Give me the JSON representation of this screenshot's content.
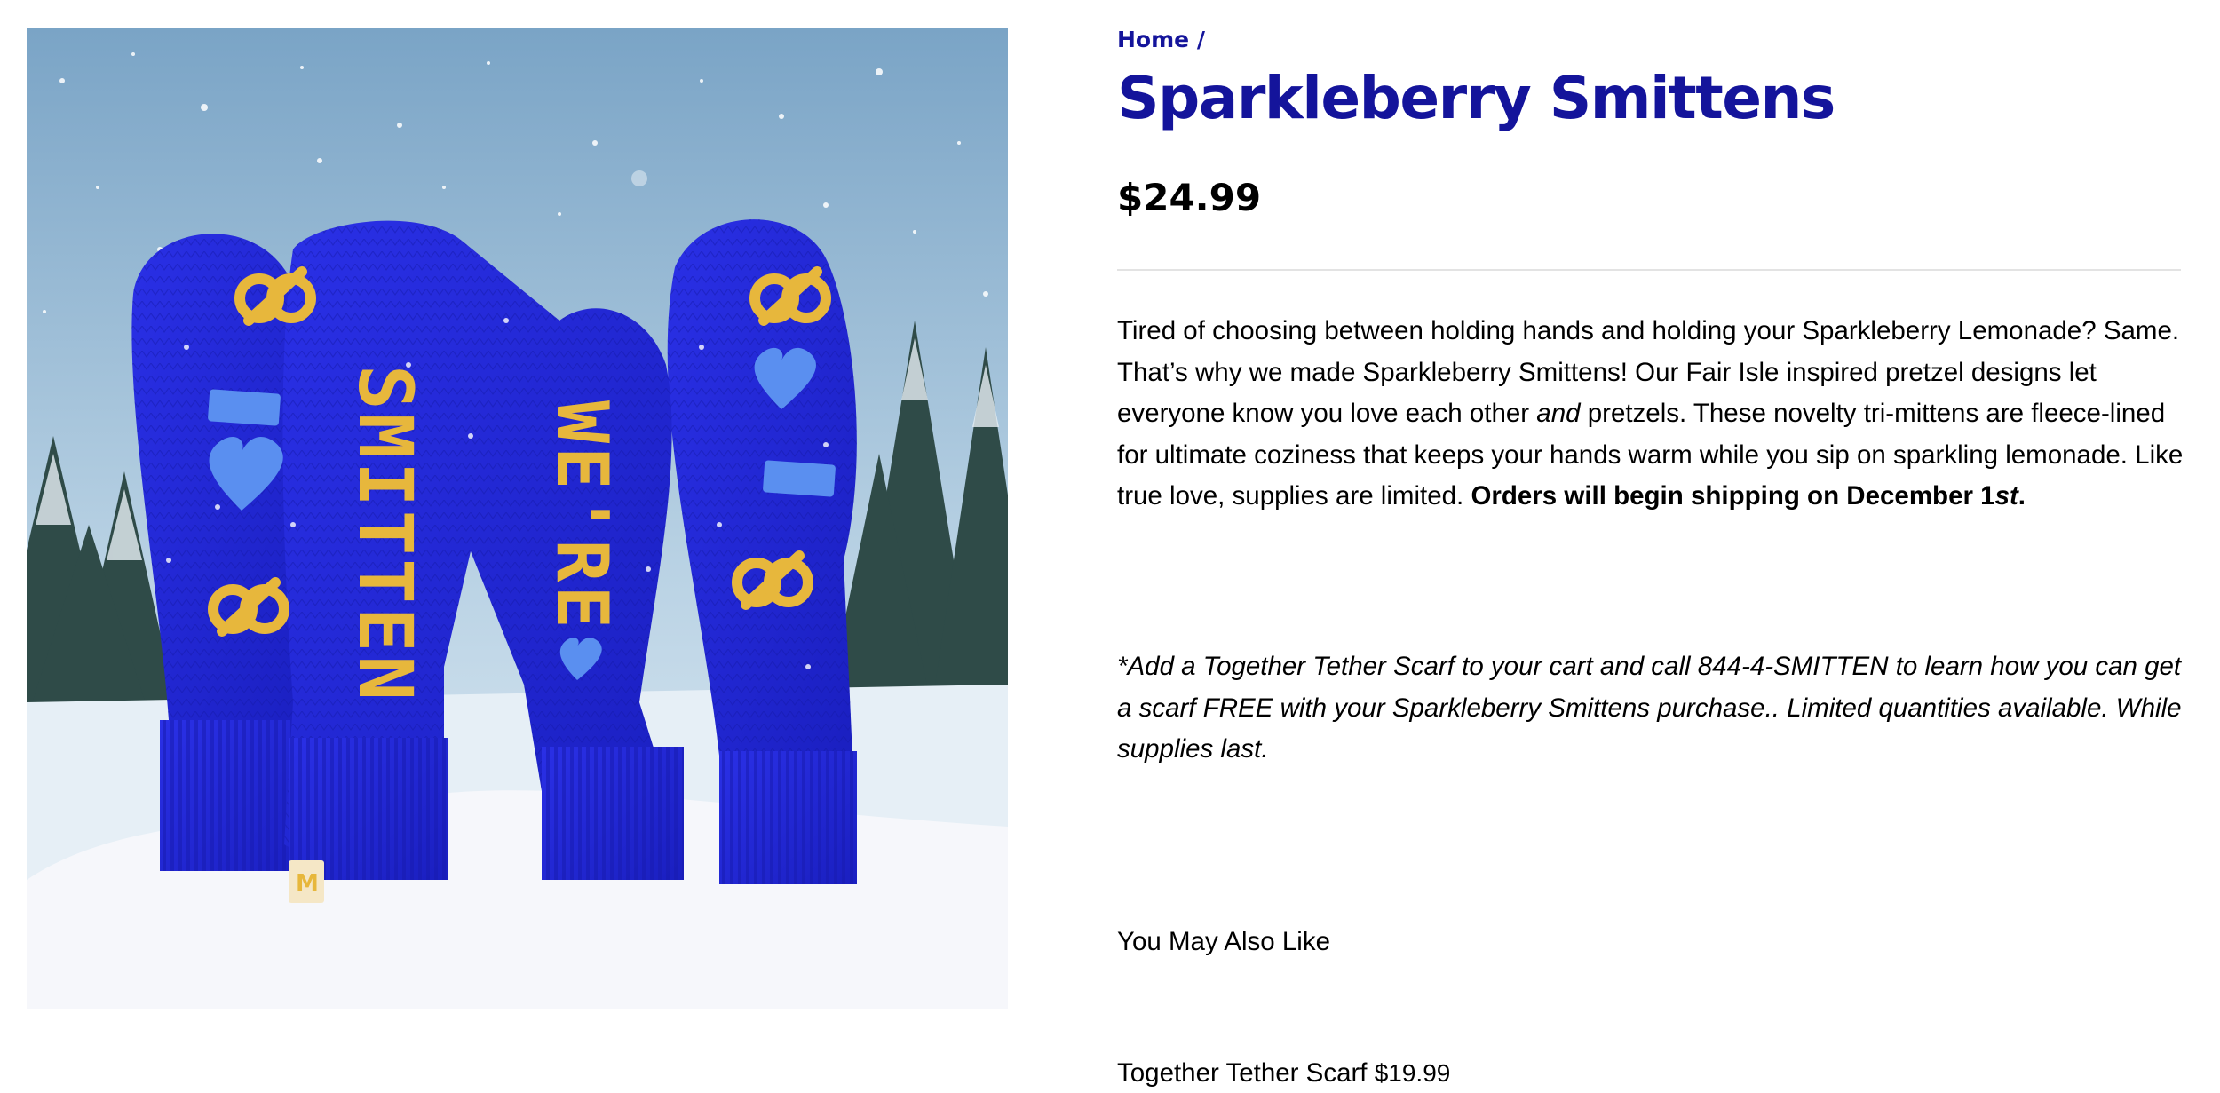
{
  "breadcrumb": {
    "home_label": "Home",
    "separator": "/"
  },
  "product": {
    "title": "Sparkleberry Smittens",
    "price": "$24.99",
    "image_alt": "Blue knit tri-mittens with pretzel pattern and the words SMITTEN and WE'RE, in the snow",
    "image_text": {
      "left_word": "SMITTEN",
      "right_word": "WE'RE"
    },
    "description": {
      "part1": "Tired of choosing between holding hands and holding your Sparkleberry Lemonade? Same. That’s why we made Sparkleberry Smittens! Our Fair Isle inspired pretzel designs let everyone know you love each other ",
      "emphasis": "and",
      "part2": " pretzels. These novelty tri-mittens are fleece-lined for ultimate coziness that keeps your hands warm while you sip on sparkling lemonade. Like true love, supplies are limited. ",
      "bold": "Orders will begin shipping on December 1",
      "bold_italic": "st",
      "bold_end": "."
    },
    "promo": "*Add a Together Tether Scarf to your cart and call 844-4-SMITTEN to learn how you can get a scarf FREE with your Sparkleberry Smittens purchase.. Limited quantities available. While supplies last."
  },
  "related": {
    "heading": "You May Also Like",
    "items": [
      {
        "name": "Together Tether Scarf",
        "price": "$19.99"
      }
    ]
  },
  "colors": {
    "brand_blue": "#14149b",
    "mitten_blue": "#1f24d6",
    "pattern_gold": "#e7b73c"
  }
}
